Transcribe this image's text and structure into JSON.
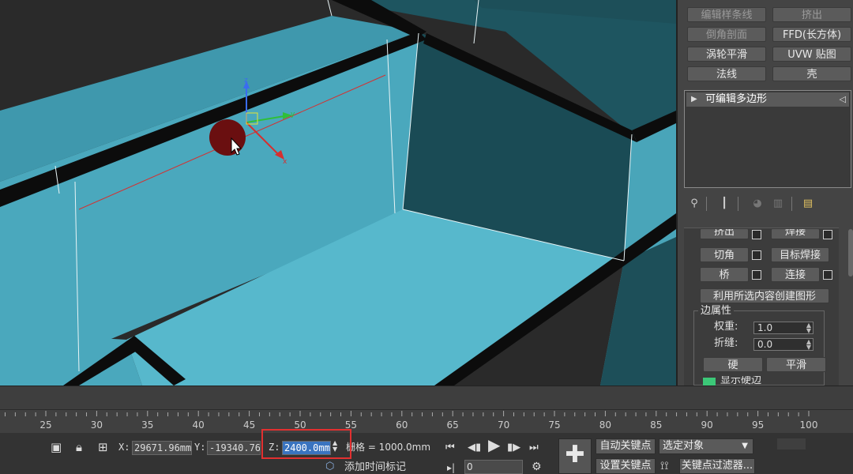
{
  "modifiers": {
    "edit_spline": "编辑样条线",
    "extrude": "挤出",
    "chamfer_profile": "倒角剖面",
    "ffd_box": "FFD(长方体)",
    "turbosmooth": "涡轮平滑",
    "uvw_map": "UVW 贴图",
    "normal": "法线",
    "shell": "壳"
  },
  "stack": {
    "item": "可编辑多边形"
  },
  "edit_edges": {
    "extrude_partial": "挤出",
    "weld_partial": "焊接",
    "chamfer": "切角",
    "target_weld": "目标焊接",
    "bridge": "桥",
    "connect": "连接",
    "create_shape": "利用所选内容创建图形",
    "group_title": "边属性",
    "weight_label": "权重:",
    "weight_value": "1.0",
    "crease_label": "折缝:",
    "crease_value": "0.0",
    "hard": "硬",
    "smooth": "平滑",
    "show_partial": "显示硬边"
  },
  "timeline": {
    "ticks": [
      "25",
      "30",
      "35",
      "40",
      "45",
      "50",
      "55",
      "60",
      "65",
      "70",
      "75",
      "80",
      "85",
      "90",
      "95",
      "100"
    ]
  },
  "status": {
    "x_label": "X:",
    "x_value": "29671.96mm",
    "y_label": "Y:",
    "y_value": "-19340.76",
    "z_label": "Z:",
    "z_value": "2400.0mm",
    "grid": "栅格 = 1000.0mm",
    "add_time_tag": "添加时间标记",
    "frame_value": "0",
    "auto_key": "自动关键点",
    "selected_object": "选定对象",
    "set_key": "设置关键点",
    "key_filters": "关键点过滤器..."
  }
}
